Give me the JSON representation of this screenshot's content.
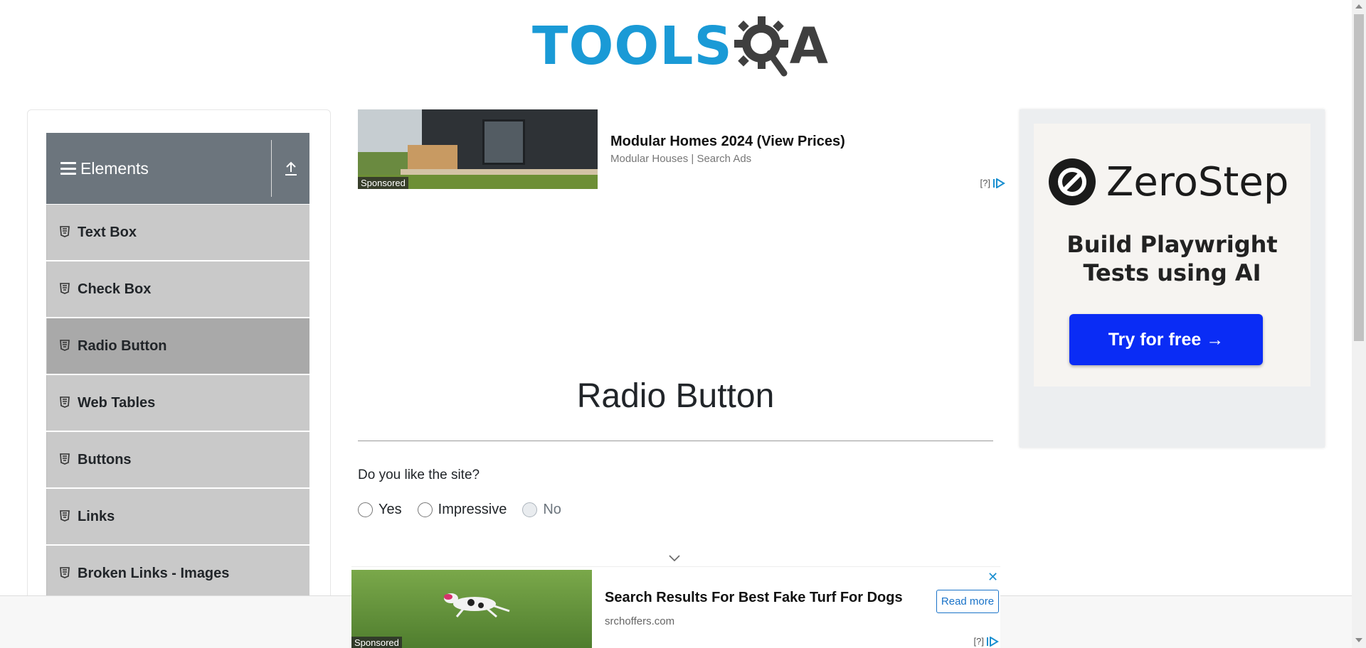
{
  "header": {
    "logo_text": "TOOLS",
    "logo_suffix": "A"
  },
  "sidebar": {
    "group_title": "Elements",
    "items": [
      {
        "label": "Text Box",
        "active": false
      },
      {
        "label": "Check Box",
        "active": false
      },
      {
        "label": "Radio Button",
        "active": true
      },
      {
        "label": "Web Tables",
        "active": false
      },
      {
        "label": "Buttons",
        "active": false
      },
      {
        "label": "Links",
        "active": false
      },
      {
        "label": "Broken Links - Images",
        "active": false
      }
    ]
  },
  "ad_top": {
    "title": "Modular Homes 2024 (View Prices)",
    "subtitle": "Modular Houses | Search Ads",
    "sponsored": "Sponsored",
    "adchoice": "[?]"
  },
  "ad_right": {
    "brand": "ZeroStep",
    "tagline_line1": "Build Playwright",
    "tagline_line2": "Tests using AI",
    "cta": "Try for free →",
    "cta_color": "#0a2cf5"
  },
  "main": {
    "title": "Radio Button",
    "question": "Do you like the site?",
    "options": [
      {
        "label": "Yes",
        "disabled": false,
        "checked": false
      },
      {
        "label": "Impressive",
        "disabled": false,
        "checked": false
      },
      {
        "label": "No",
        "disabled": true,
        "checked": false
      }
    ]
  },
  "ad_bottom": {
    "title": "Search Results For Best Fake Turf For Dogs",
    "subtitle": "srchoffers.com",
    "cta": "Read more",
    "sponsored": "Sponsored",
    "adchoice": "[?]",
    "close": "✕"
  },
  "colors": {
    "logo_blue": "#1a9ad6",
    "sidebar_header": "#6c757d",
    "menu_item": "#c9c9c9",
    "menu_item_active": "#a9a9a9"
  }
}
